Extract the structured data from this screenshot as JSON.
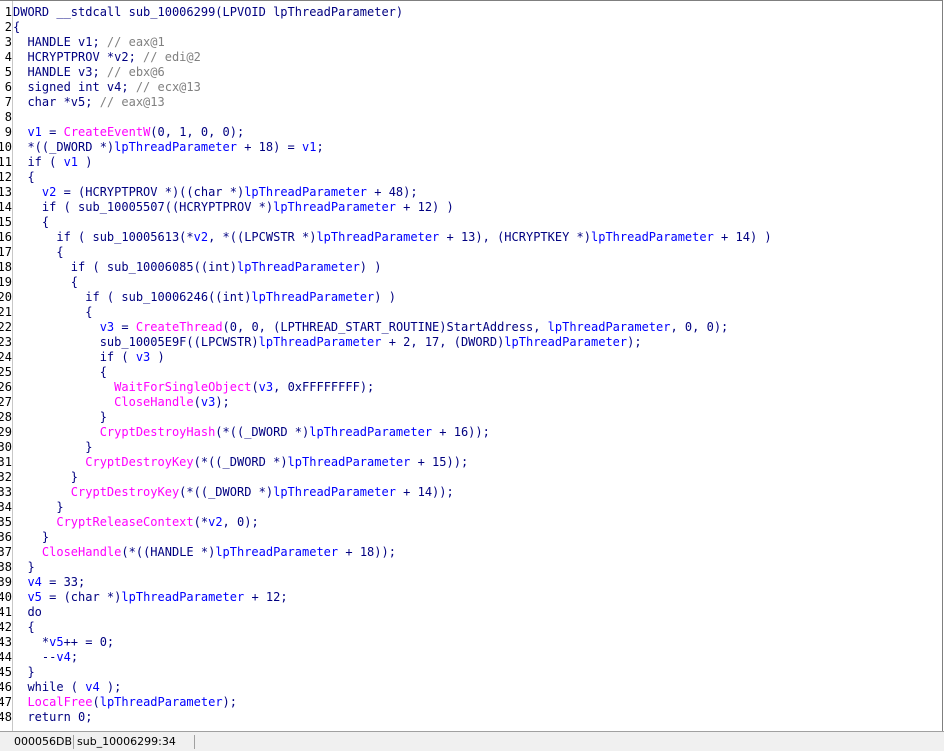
{
  "gutter": [
    "1",
    "2",
    "3",
    "4",
    "5",
    "6",
    "7",
    "8",
    "9",
    "10",
    "11",
    "12",
    "13",
    "14",
    "15",
    "16",
    "17",
    "18",
    "19",
    "20",
    "21",
    "22",
    "23",
    "24",
    "25",
    "26",
    "27",
    "28",
    "29",
    "30",
    "31",
    "32",
    "33",
    "34",
    "35",
    "36",
    "37",
    "38",
    "39",
    "40",
    "41",
    "42",
    "43",
    "44",
    "45",
    "46",
    "47",
    "48"
  ],
  "code_lines": [
    [
      [
        "t",
        "DWORD __stdcall sub_10006299(LPVOID lpThreadParameter)"
      ]
    ],
    [
      [
        "t",
        "{"
      ]
    ],
    [
      [
        "t",
        "  HANDLE v1; "
      ],
      [
        "c",
        "// eax@1"
      ]
    ],
    [
      [
        "t",
        "  HCRYPTPROV *v2; "
      ],
      [
        "c",
        "// edi@2"
      ]
    ],
    [
      [
        "t",
        "  HANDLE v3; "
      ],
      [
        "c",
        "// ebx@6"
      ]
    ],
    [
      [
        "t",
        "  signed int v4; "
      ],
      [
        "c",
        "// ecx@13"
      ]
    ],
    [
      [
        "t",
        "  char *v5; "
      ],
      [
        "c",
        "// eax@13"
      ]
    ],
    [
      [
        "t",
        ""
      ]
    ],
    [
      [
        "t",
        "  "
      ],
      [
        "v",
        "v1"
      ],
      [
        "t",
        " = "
      ],
      [
        "f",
        "CreateEventW"
      ],
      [
        "t",
        "(0, 1, 0, 0);"
      ]
    ],
    [
      [
        "t",
        "  *((_DWORD *)"
      ],
      [
        "v",
        "lpThreadParameter"
      ],
      [
        "t",
        " + 18) = "
      ],
      [
        "v",
        "v1"
      ],
      [
        "t",
        ";"
      ]
    ],
    [
      [
        "t",
        "  if ( "
      ],
      [
        "v",
        "v1"
      ],
      [
        "t",
        " )"
      ]
    ],
    [
      [
        "t",
        "  {"
      ]
    ],
    [
      [
        "t",
        "    "
      ],
      [
        "v",
        "v2"
      ],
      [
        "t",
        " = (HCRYPTPROV *)((char *)"
      ],
      [
        "v",
        "lpThreadParameter"
      ],
      [
        "t",
        " + 48);"
      ]
    ],
    [
      [
        "t",
        "    if ( sub_10005507((HCRYPTPROV *)"
      ],
      [
        "v",
        "lpThreadParameter"
      ],
      [
        "t",
        " + 12) )"
      ]
    ],
    [
      [
        "t",
        "    {"
      ]
    ],
    [
      [
        "t",
        "      if ( sub_10005613(*"
      ],
      [
        "v",
        "v2"
      ],
      [
        "t",
        ", *((LPCWSTR *)"
      ],
      [
        "v",
        "lpThreadParameter"
      ],
      [
        "t",
        " + 13), (HCRYPTKEY *)"
      ],
      [
        "v",
        "lpThreadParameter"
      ],
      [
        "t",
        " + 14) )"
      ]
    ],
    [
      [
        "t",
        "      {"
      ]
    ],
    [
      [
        "t",
        "        if ( sub_10006085((int)"
      ],
      [
        "v",
        "lpThreadParameter"
      ],
      [
        "t",
        ") )"
      ]
    ],
    [
      [
        "t",
        "        {"
      ]
    ],
    [
      [
        "t",
        "          if ( sub_10006246((int)"
      ],
      [
        "v",
        "lpThreadParameter"
      ],
      [
        "t",
        ") )"
      ]
    ],
    [
      [
        "t",
        "          {"
      ]
    ],
    [
      [
        "t",
        "            "
      ],
      [
        "v",
        "v3"
      ],
      [
        "t",
        " = "
      ],
      [
        "f",
        "CreateThread"
      ],
      [
        "t",
        "(0, 0, (LPTHREAD_START_ROUTINE)StartAddress, "
      ],
      [
        "v",
        "lpThreadParameter"
      ],
      [
        "t",
        ", 0, 0);"
      ]
    ],
    [
      [
        "t",
        "            sub_10005E9F((LPCWSTR)"
      ],
      [
        "v",
        "lpThreadParameter"
      ],
      [
        "t",
        " + 2, 17, (DWORD)"
      ],
      [
        "v",
        "lpThreadParameter"
      ],
      [
        "t",
        ");"
      ]
    ],
    [
      [
        "t",
        "            if ( "
      ],
      [
        "v",
        "v3"
      ],
      [
        "t",
        " )"
      ]
    ],
    [
      [
        "t",
        "            {"
      ]
    ],
    [
      [
        "t",
        "              "
      ],
      [
        "f",
        "WaitForSingleObject"
      ],
      [
        "t",
        "("
      ],
      [
        "v",
        "v3"
      ],
      [
        "t",
        ", 0xFFFFFFFF);"
      ]
    ],
    [
      [
        "t",
        "              "
      ],
      [
        "f",
        "CloseHandle"
      ],
      [
        "t",
        "("
      ],
      [
        "v",
        "v3"
      ],
      [
        "t",
        ");"
      ]
    ],
    [
      [
        "t",
        "            }"
      ]
    ],
    [
      [
        "t",
        "            "
      ],
      [
        "f",
        "CryptDestroyHash"
      ],
      [
        "t",
        "(*((_DWORD *)"
      ],
      [
        "v",
        "lpThreadParameter"
      ],
      [
        "t",
        " + 16));"
      ]
    ],
    [
      [
        "t",
        "          }"
      ]
    ],
    [
      [
        "t",
        "          "
      ],
      [
        "f",
        "CryptDestroyKey"
      ],
      [
        "t",
        "(*((_DWORD *)"
      ],
      [
        "v",
        "lpThreadParameter"
      ],
      [
        "t",
        " + 15));"
      ]
    ],
    [
      [
        "t",
        "        }"
      ]
    ],
    [
      [
        "t",
        "        "
      ],
      [
        "f",
        "CryptDestroyKey"
      ],
      [
        "t",
        "(*((_DWORD *)"
      ],
      [
        "v",
        "lpThreadParameter"
      ],
      [
        "t",
        " + 14));"
      ]
    ],
    [
      [
        "t",
        "      }"
      ]
    ],
    [
      [
        "t",
        "      "
      ],
      [
        "f",
        "CryptReleaseContext"
      ],
      [
        "t",
        "(*"
      ],
      [
        "v",
        "v2"
      ],
      [
        "t",
        ", 0);"
      ]
    ],
    [
      [
        "t",
        "    }"
      ]
    ],
    [
      [
        "t",
        "    "
      ],
      [
        "f",
        "CloseHandle"
      ],
      [
        "t",
        "(*((HANDLE *)"
      ],
      [
        "v",
        "lpThreadParameter"
      ],
      [
        "t",
        " + 18));"
      ]
    ],
    [
      [
        "t",
        "  }"
      ]
    ],
    [
      [
        "t",
        "  "
      ],
      [
        "v",
        "v4"
      ],
      [
        "t",
        " = 33;"
      ]
    ],
    [
      [
        "t",
        "  "
      ],
      [
        "v",
        "v5"
      ],
      [
        "t",
        " = (char *)"
      ],
      [
        "v",
        "lpThreadParameter"
      ],
      [
        "t",
        " + 12;"
      ]
    ],
    [
      [
        "t",
        "  do"
      ]
    ],
    [
      [
        "t",
        "  {"
      ]
    ],
    [
      [
        "t",
        "    *"
      ],
      [
        "v",
        "v5"
      ],
      [
        "t",
        "++ = 0;"
      ]
    ],
    [
      [
        "t",
        "    --"
      ],
      [
        "v",
        "v4"
      ],
      [
        "t",
        ";"
      ]
    ],
    [
      [
        "t",
        "  }"
      ]
    ],
    [
      [
        "t",
        "  while ( "
      ],
      [
        "v",
        "v4"
      ],
      [
        "t",
        " );"
      ]
    ],
    [
      [
        "t",
        "  "
      ],
      [
        "f",
        "LocalFree"
      ],
      [
        "t",
        "("
      ],
      [
        "v",
        "lpThreadParameter"
      ],
      [
        "t",
        ");"
      ]
    ],
    [
      [
        "t",
        "  return 0;"
      ]
    ]
  ],
  "token_colors": {
    "text": "#000080",
    "variable": "#0000ff",
    "comment": "#808080",
    "api_call": "#ff00ff"
  },
  "status_bar": {
    "address": "000056DB",
    "location": "sub_10006299:34"
  }
}
